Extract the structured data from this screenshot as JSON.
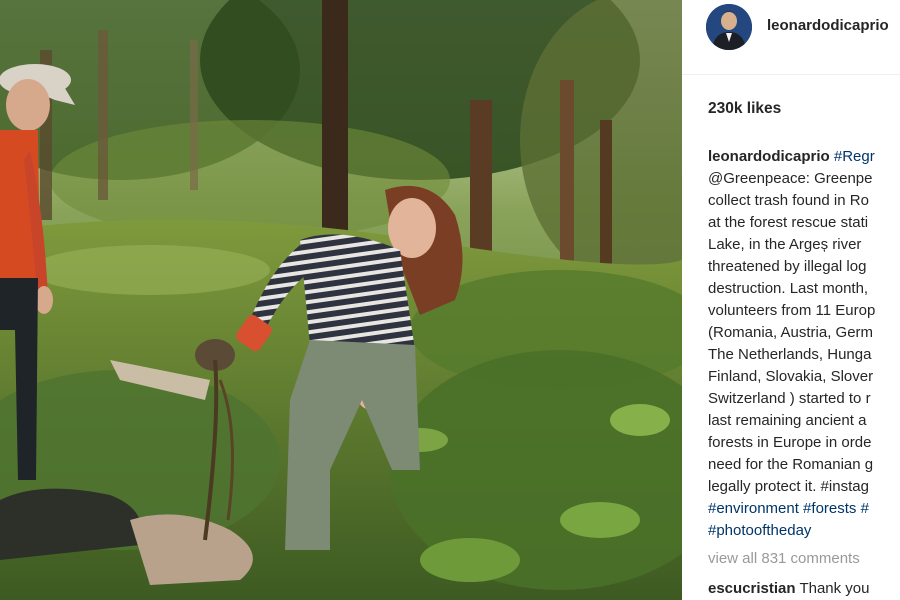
{
  "post": {
    "username": "leonardodicaprio",
    "likes_text": "230k likes",
    "caption": {
      "username": "leonardodicaprio",
      "first_tag": "#Regr",
      "lines": [
        "@Greenpeace: Greenpe",
        "collect trash found in Ro",
        "at the forest rescue stati",
        "Lake, in the Argeș river",
        "threatened by illegal log",
        "destruction. Last month,",
        "volunteers from 11 Europ",
        "(Romania, Austria, Germ",
        "The Netherlands, Hunga",
        "Finland, Slovakia, Slover",
        "Switzerland ) started to r",
        "last remaining ancient a",
        "forests in Europe in orde",
        "need for the Romanian g",
        "legally protect it. #instag"
      ],
      "tag_line": "#environment #forests #",
      "last_tag": "#photooftheday"
    },
    "view_all_comments": "view all 831 comments",
    "comment": {
      "username": "escucristian",
      "text": "Thank you"
    }
  },
  "icons": {
    "avatar": "profile-avatar"
  },
  "colors": {
    "text": "#262626",
    "muted": "#999999",
    "hashtag": "#003569",
    "divider": "#efefef"
  }
}
